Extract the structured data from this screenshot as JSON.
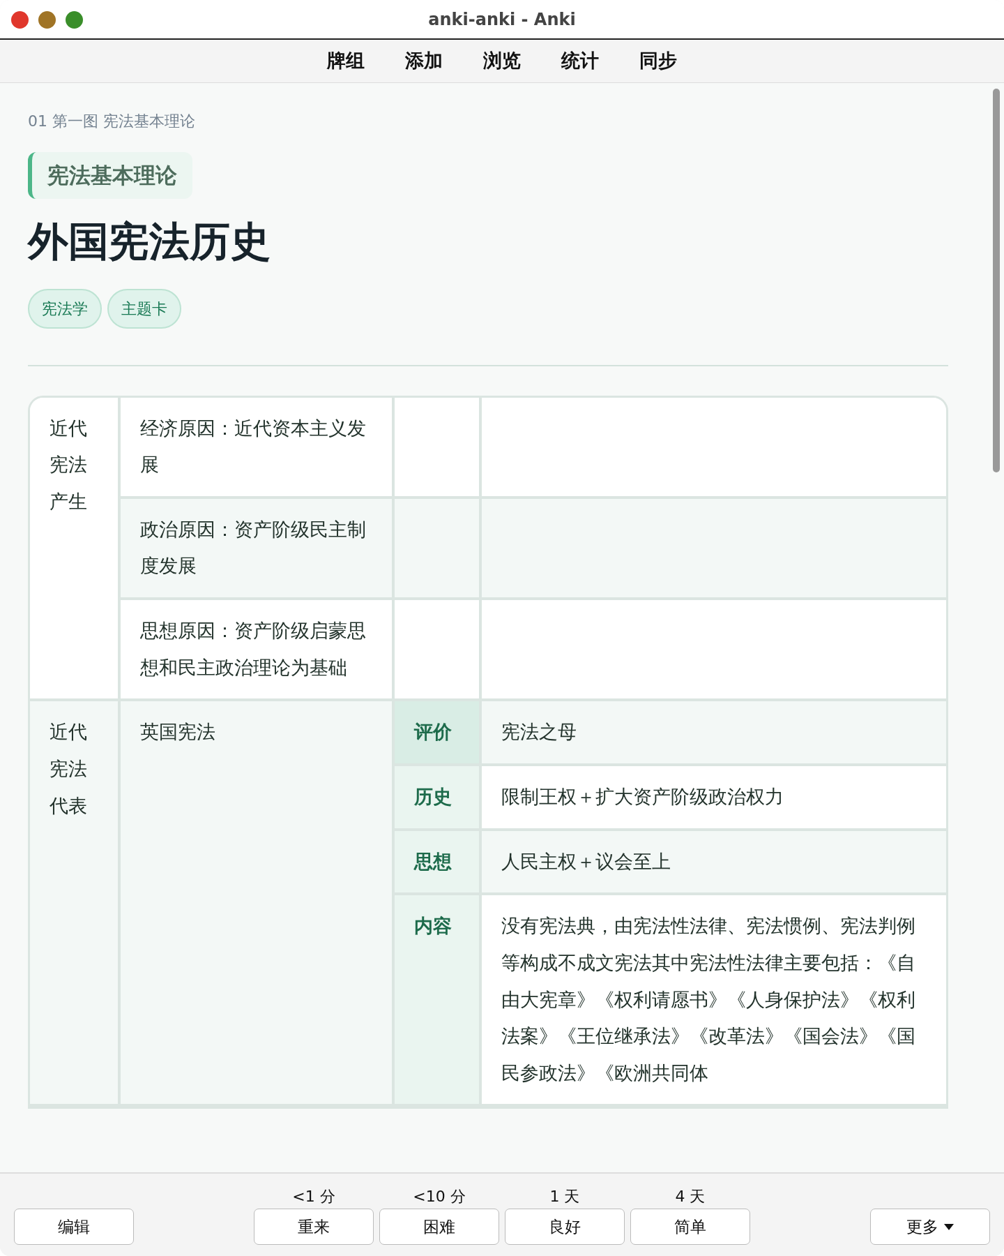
{
  "window": {
    "title": "anki-anki - Anki"
  },
  "toolbar": [
    "牌组",
    "添加",
    "浏览",
    "统计",
    "同步"
  ],
  "card": {
    "breadcrumb": "01 第一图 宪法基本理论",
    "section": "宪法基本理论",
    "title": "外国宪法历史",
    "tags": [
      "宪法学",
      "主题卡"
    ],
    "table": [
      {
        "kind": "causes",
        "heading": "近代宪法产生",
        "rows": [
          {
            "text": "经济原因：近代资本主义发展"
          },
          {
            "text": "政治原因：资产阶级民主制度发展"
          },
          {
            "text": "思想原因：资产阶级启蒙思想和民主政治理论为基础"
          }
        ]
      },
      {
        "kind": "details",
        "heading": "近代宪法代表",
        "subject": "英国宪法",
        "rows": [
          {
            "label": "评价",
            "value": "宪法之母"
          },
          {
            "label": "历史",
            "value": "限制王权＋扩大资产阶级政治权力"
          },
          {
            "label": "思想",
            "value": "人民主权＋议会至上"
          },
          {
            "label": "内容",
            "value": "没有宪法典，由宪法性法律、宪法惯例、宪法判例等构成不成文宪法其中宪法性法律主要包括：《自由大宪章》《权利请愿书》《人身保护法》《权利法案》《王位继承法》《改革法》《国会法》《国民参政法》《欧洲共同体"
          }
        ]
      }
    ]
  },
  "answer_bar": {
    "edit": "编辑",
    "answers": [
      {
        "time": "<1 分",
        "label": "重来"
      },
      {
        "time": "<10 分",
        "label": "困难"
      },
      {
        "time": "1 天",
        "label": "良好"
      },
      {
        "time": "4 天",
        "label": "简单"
      }
    ],
    "more": "更多"
  }
}
